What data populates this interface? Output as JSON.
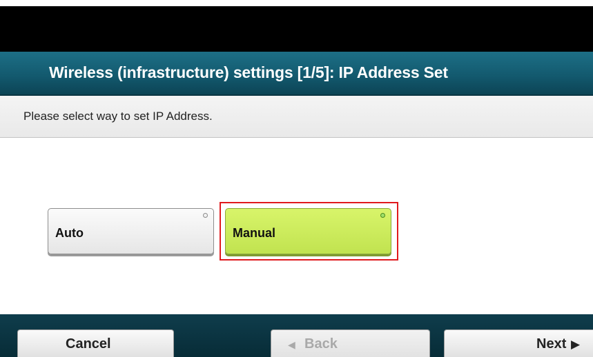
{
  "header": {
    "title": "Wireless (infrastructure) settings [1/5]: IP Address Set"
  },
  "instruction": "Please select way to set IP Address.",
  "options": [
    {
      "label": "Auto",
      "selected": false
    },
    {
      "label": "Manual",
      "selected": true
    }
  ],
  "footer": {
    "cancel_label": "Cancel",
    "back_label": "Back",
    "back_icon": "left-triangle-icon",
    "back_enabled": false,
    "next_label": "Next",
    "next_icon": "right-triangle-icon"
  },
  "colors": {
    "title_bar": "#135a6f",
    "selected_option": "#c8ea58",
    "selection_outline": "#e0191d",
    "footer_bar": "#0b3440"
  }
}
